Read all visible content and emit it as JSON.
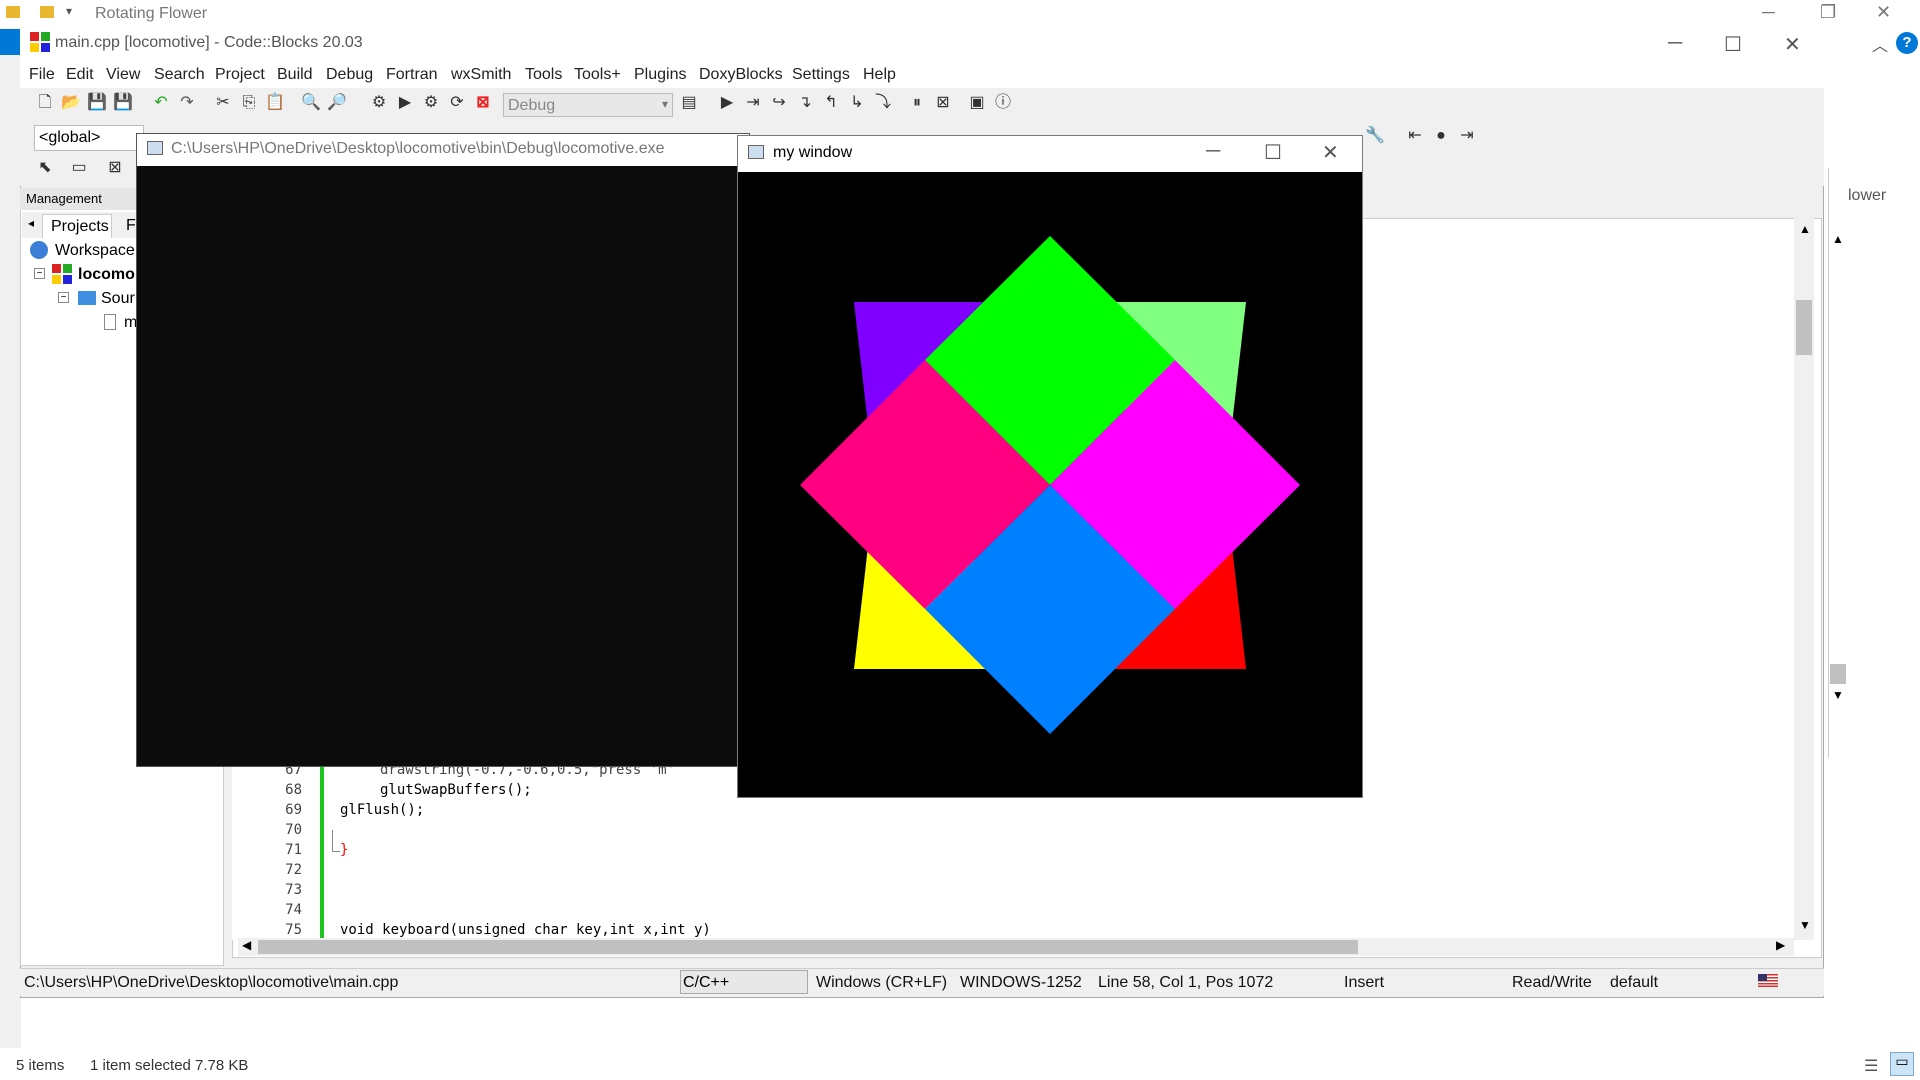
{
  "explorer": {
    "title": "Rotating Flower",
    "right_text": "lower",
    "status_items": "5 items",
    "status_selected": "1 item selected  7.78 KB"
  },
  "codeblocks": {
    "title": "main.cpp [locomotive] - Code::Blocks 20.03",
    "menu": [
      "File",
      "Edit",
      "View",
      "Search",
      "Project",
      "Build",
      "Debug",
      "Fortran",
      "wxSmith",
      "Tools",
      "Tools+",
      "Plugins",
      "DoxyBlocks",
      "Settings",
      "Help"
    ],
    "build_target": "Debug",
    "scope": "<global>",
    "management": {
      "header": "Management",
      "tab_projects": "Projects",
      "tab_files": "F",
      "tree": [
        "Workspace",
        "locomo",
        "Sour",
        "m"
      ]
    },
    "editor": {
      "lines": [
        {
          "num": "67",
          "code": "drawstring(-0.7,-0.6,0.5,\"press 'm'"
        },
        {
          "num": "68",
          "code": "glutSwapBuffers();"
        },
        {
          "num": "69",
          "code": "glFlush();"
        },
        {
          "num": "70",
          "code": ""
        },
        {
          "num": "71",
          "code": "}"
        },
        {
          "num": "72",
          "code": ""
        },
        {
          "num": "73",
          "code": ""
        },
        {
          "num": "74",
          "code": ""
        },
        {
          "num": "75",
          "code": "void keyboard(unsigned char key,int x,int y)"
        }
      ]
    },
    "status": {
      "path": "C:\\Users\\HP\\OneDrive\\Desktop\\locomotive\\main.cpp",
      "language": "C/C++",
      "line_endings": "Windows (CR+LF)",
      "encoding": "WINDOWS-1252",
      "position": "Line 58, Col 1, Pos 1072",
      "mode": "Insert",
      "access": "Read/Write",
      "profile": "default"
    }
  },
  "console": {
    "title": "C:\\Users\\HP\\OneDrive\\Desktop\\locomotive\\bin\\Debug\\locomotive.exe"
  },
  "glut": {
    "title": "my window",
    "shapes": {
      "triangle_purple": "#8000ff",
      "triangle_lightgreen": "#80ff80",
      "triangle_yellow": "#ffff00",
      "triangle_red": "#ff0000",
      "diamond_top": "#00ff00",
      "diamond_left": "#ff0080",
      "diamond_right": "#ff00ff",
      "diamond_bottom": "#0080ff"
    }
  }
}
